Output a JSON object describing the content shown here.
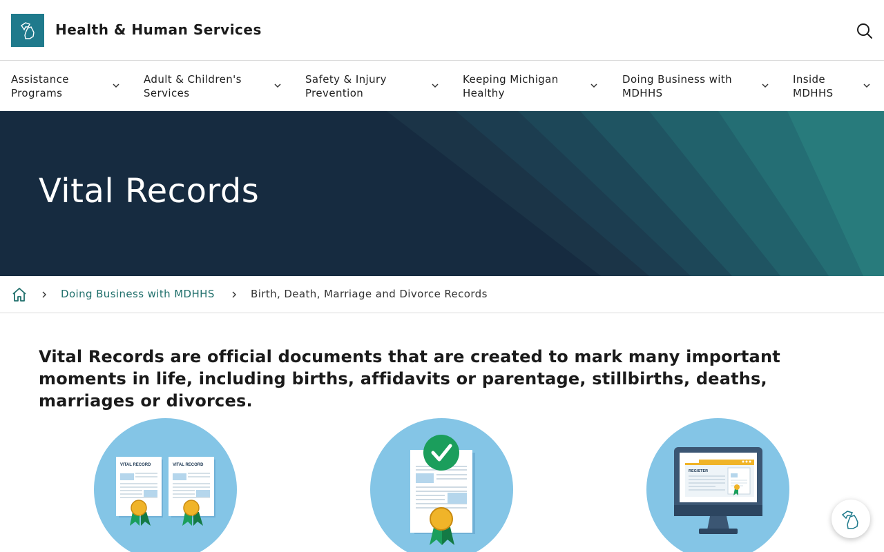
{
  "header": {
    "site_title": "Health & Human Services",
    "logo_icon": "michigan-map-icon",
    "search_icon": "search-icon"
  },
  "nav": {
    "items": [
      {
        "label": "Assistance\nPrograms"
      },
      {
        "label": "Adult & Children's\nServices"
      },
      {
        "label": "Safety & Injury\nPrevention"
      },
      {
        "label": "Keeping Michigan\nHealthy"
      },
      {
        "label": "Doing Business with\nMDHHS"
      },
      {
        "label": "Inside\nMDHHS"
      }
    ]
  },
  "hero": {
    "title": "Vital Records"
  },
  "breadcrumb": {
    "home_icon": "home-icon",
    "link": "Doing Business with MDHHS",
    "current": "Birth, Death, Marriage and Divorce Records"
  },
  "intro": {
    "text": "Vital Records are official documents that are created to mark many important moments in life, including births, affidavits or parentage, stillbirths, deaths, marriages or divorces."
  },
  "illustrations": {
    "card1_label_a": "VITAL RECORD",
    "card1_label_b": "VITAL RECORD",
    "card3_label": "REGISTER"
  },
  "colors": {
    "brand": "#1f7a8c",
    "hero_bg": "#162b40",
    "link": "#1f6f6b",
    "circle": "#84c5e6"
  }
}
